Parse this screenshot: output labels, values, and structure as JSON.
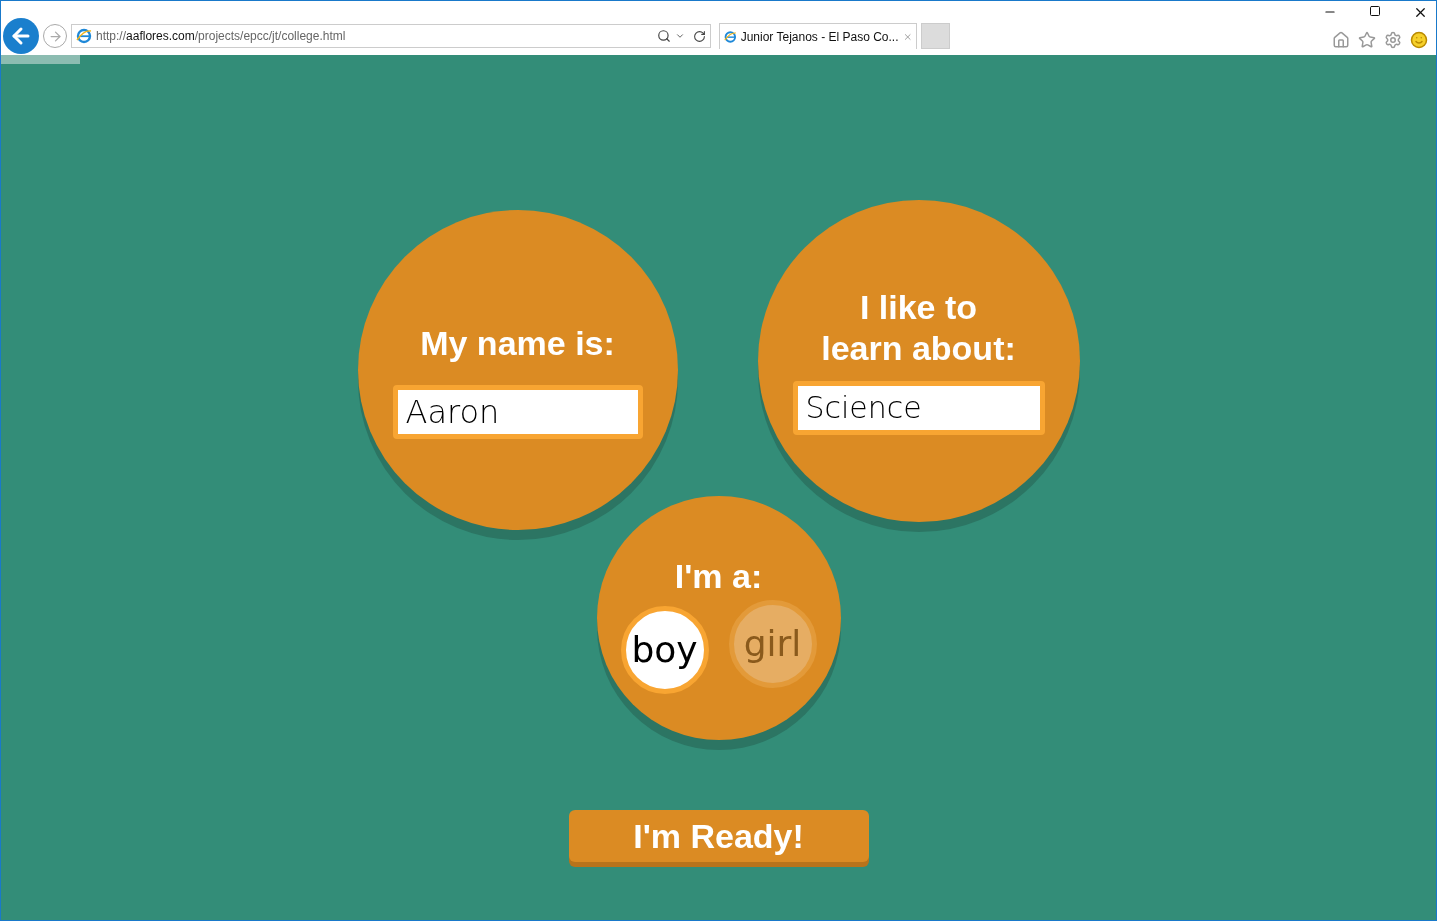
{
  "browser": {
    "url": {
      "scheme": "http://",
      "domain": "aaflores.com",
      "path": "/projects/epcc/jt/college.html"
    },
    "tabs": [
      {
        "title": "Junior Tejanos - El Paso Co...",
        "selected": true
      }
    ],
    "loading_bar": {
      "level": 0.055
    }
  },
  "form": {
    "name": {
      "label": "My name is:",
      "value": "Aaron"
    },
    "interest": {
      "label_lines": [
        "I like to",
        "learn about:"
      ],
      "value": "Science"
    },
    "gender": {
      "label": "I'm a:",
      "options": [
        {
          "label": "boy",
          "selected": true
        },
        {
          "label": "girl",
          "selected": false
        }
      ]
    },
    "submit": "I'm Ready!"
  }
}
